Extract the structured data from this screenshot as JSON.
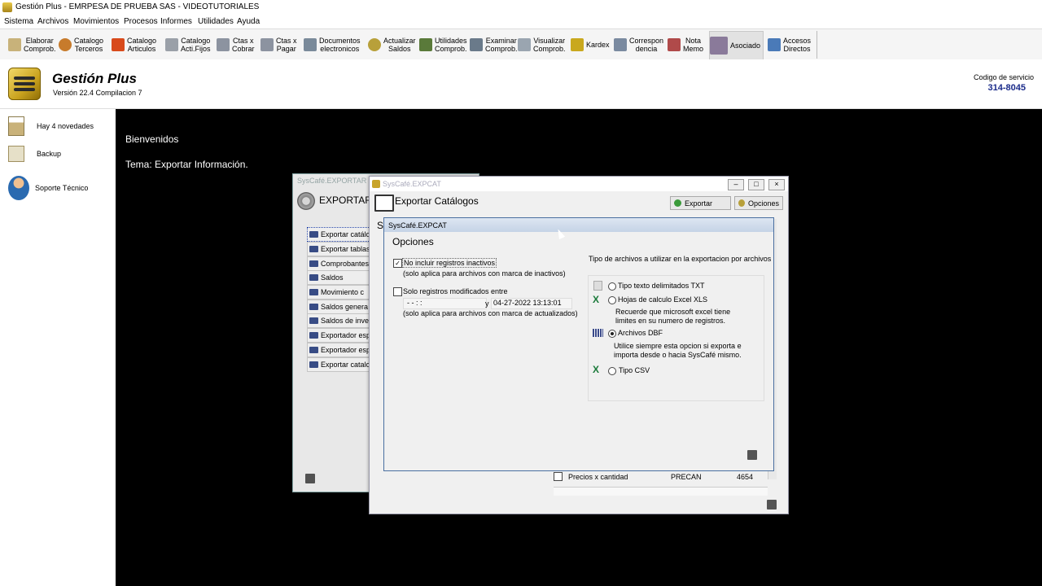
{
  "titlebar": {
    "title": "Gestión Plus - EMRPESA DE PRUEBA SAS - VIDEOTUTORIALES"
  },
  "menu": [
    "Sistema",
    "Archivos",
    "Movimientos",
    "Procesos",
    "Informes",
    "Utilidades",
    "Ayuda"
  ],
  "toolbar": [
    {
      "label": "Elaborar\nComprob.",
      "icon": "pencil-icon"
    },
    {
      "label": "Catalogo\nTerceros",
      "icon": "user-icon"
    },
    {
      "label": "Catalogo\nArticulos",
      "icon": "box-icon"
    },
    {
      "label": "Catalogo\nActi.Fijos",
      "icon": "tools-icon"
    },
    {
      "label": "Ctas x\nCobrar",
      "icon": "money-in-icon"
    },
    {
      "label": "Ctas x\nPagar",
      "icon": "money-out-icon"
    },
    {
      "label": "Documentos\nelectronicos",
      "icon": "doc-icon"
    },
    {
      "label": "Actualizar\nSaldos",
      "icon": "gear-icon"
    },
    {
      "label": "Utilidades\nComprob.",
      "icon": "utilities-icon"
    },
    {
      "label": "Examinar\nComprob.",
      "icon": "examine-icon"
    },
    {
      "label": "Visualizar\nComprob.",
      "icon": "view-icon"
    },
    {
      "label": "Kardex",
      "icon": "kardex-icon"
    },
    {
      "label": "Correspon\ndencia",
      "icon": "mail-icon"
    },
    {
      "label": "Nota\nMemo",
      "icon": "note-icon"
    },
    {
      "label": "Asociado",
      "icon": "associate-icon"
    },
    {
      "label": "Accesos\nDirectos",
      "icon": "folder-icon"
    }
  ],
  "header": {
    "app_name": "Gestión Plus",
    "version": "Versión 22.4  Compilacion 7",
    "service_label": "Codigo de servicio",
    "service_code": "314-8045"
  },
  "sidebar": [
    {
      "label": "Hay 4 novedades",
      "icon": "clipboard-icon"
    },
    {
      "label": "Backup",
      "icon": "backup-icon"
    },
    {
      "label": "Soporte Técnico",
      "icon": "support-icon"
    }
  ],
  "main": {
    "welcome": "Bienvenidos",
    "topic": "Tema: Exportar Información."
  },
  "w1": {
    "title": "SysCafé.EXPORTAR",
    "heading": "EXPORTAR",
    "items": [
      "Exportar catálogos",
      "Exportar tablas",
      "Comprobantes",
      "Saldos",
      "Movimiento c",
      "Saldos genera",
      "Saldos de inve",
      "Exportador esp",
      "Exportador esp",
      "Exportar catalo"
    ]
  },
  "w2": {
    "title": "SysCafé.EXPCAT",
    "heading": "Exportar Catálogos",
    "export_btn": "Exportar",
    "options_btn": "Opciones",
    "side_letter": "S",
    "row": {
      "name": "Precios x cantidad",
      "code": "PRECAN",
      "count": "4654"
    }
  },
  "dialog": {
    "title": "SysCafé.EXPCAT",
    "heading": "Opciones",
    "opt1": "No incluir registros inactivos",
    "opt1_note": "(solo aplica para archivos con marca de inactivos)",
    "opt2": "Solo registros modificados entre",
    "date_from": "- -      : :",
    "date_sep": "y",
    "date_to": "04-27-2022 13:13:01",
    "opt2_note": "(solo aplica para archivos con marca de actualizados)",
    "type_title": "Tipo de archivos a utilizar en la exportacion por archivos",
    "types": [
      {
        "label": "Tipo texto delimitados TXT",
        "icon": "txt-file-icon",
        "selected": false
      },
      {
        "label": "Hojas de calculo Excel XLS",
        "icon": "excel-icon",
        "selected": false
      },
      {
        "label": "Archivos DBF",
        "icon": "dbf-icon",
        "selected": true
      },
      {
        "label": "Tipo CSV",
        "icon": "csv-icon",
        "selected": false
      }
    ],
    "xls_note1": "Recuerde que microsoft excel tiene",
    "xls_note2": "limites en su numero de registros.",
    "dbf_note1": "Utilice siempre esta opcion si exporta e",
    "dbf_note2": "importa desde o hacia SysCafé mismo."
  },
  "colors": {
    "main_bg": "#000000",
    "service_code": "#1a2b8a",
    "dialog_border": "#4a6fa0"
  }
}
